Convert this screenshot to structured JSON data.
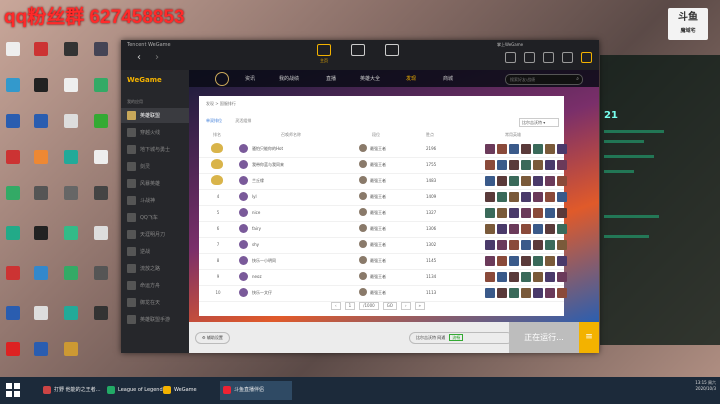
{
  "banner": "qq粉丝群 627458853",
  "stream_logo": {
    "title": "斗鱼",
    "sub": "魔域宅"
  },
  "stream_number": "21",
  "window": {
    "title": "Tencent WeGame",
    "user": "掌上WeGame",
    "topnav": [
      {
        "label": "主页",
        "icon": "home-icon"
      },
      {
        "label": "",
        "icon": "monitor-icon"
      },
      {
        "label": "",
        "icon": "battery-icon"
      }
    ]
  },
  "sidebar": {
    "brand": "WeGame",
    "section": "我的应用",
    "items": [
      "英雄联盟",
      "穿越火线",
      "地下城与勇士",
      "剑灵",
      "风暴英雄",
      "斗战神",
      "QQ飞车",
      "天涯明月刀",
      "逆战",
      "流放之路",
      "命运方舟",
      "御龙在天",
      "英雄联盟手游"
    ]
  },
  "lol_nav": {
    "items": [
      "资讯",
      "我的战绩",
      "直播",
      "英雄大全",
      "发现",
      "商城"
    ],
    "active": 4,
    "search_placeholder": "搜索好友/战绩"
  },
  "panel": {
    "breadcrumb": "发现 > 国服排行",
    "tabs": [
      "单双排位",
      "灵活组排"
    ],
    "select": "比尔吉沃特",
    "headers": {
      "rank": "排名",
      "name": "召唤师名称",
      "tier": "段位",
      "score": "胜点",
      "heroes": "常用英雄"
    },
    "rows": [
      {
        "rank": "1",
        "name": "骚怕只能你的Hot",
        "tier": "最强王者",
        "score": "2196"
      },
      {
        "rank": "2",
        "name": "我带你蓝与我同来",
        "tier": "最强王者",
        "score": "1755"
      },
      {
        "rank": "3",
        "name": "兰丘缘",
        "tier": "最强王者",
        "score": "1483"
      },
      {
        "rank": "4",
        "name": "lyl",
        "tier": "最强王者",
        "score": "1409"
      },
      {
        "rank": "5",
        "name": "nice",
        "tier": "最强王者",
        "score": "1327"
      },
      {
        "rank": "6",
        "name": "fairy",
        "tier": "最强王者",
        "score": "1306"
      },
      {
        "rank": "7",
        "name": "shy",
        "tier": "最强王者",
        "score": "1302"
      },
      {
        "rank": "8",
        "name": "快乐—小明同",
        "tier": "最强王者",
        "score": "1145"
      },
      {
        "rank": "9",
        "name": "neoz",
        "tier": "最强王者",
        "score": "1134"
      },
      {
        "rank": "10",
        "name": "快乐—文仔",
        "tier": "最强王者",
        "score": "1113"
      }
    ],
    "pager": [
      "‹",
      "1",
      "/1000",
      "GO",
      "›",
      "»"
    ]
  },
  "bottom": {
    "assist": "辅助设置",
    "zone": "比尔吉沃特 网通",
    "zone_status": "流畅",
    "running": "正在运行...",
    "menu": "≡"
  },
  "taskbar": {
    "tasks": [
      {
        "label": "打野 他能的之王者…",
        "color": "#c44"
      },
      {
        "label": "League of Legends",
        "color": "#2a6"
      },
      {
        "label": "WeGame",
        "color": "#f3b200"
      },
      {
        "label": "斗鱼直播伴侣",
        "color": "#e23"
      }
    ],
    "active": 3,
    "time": "13:15 周六",
    "date": "2020/10/3"
  },
  "colors": {
    "accent": "#f3b200",
    "running_bg": "#bdbdbd",
    "banner": "#ff2a2a"
  }
}
